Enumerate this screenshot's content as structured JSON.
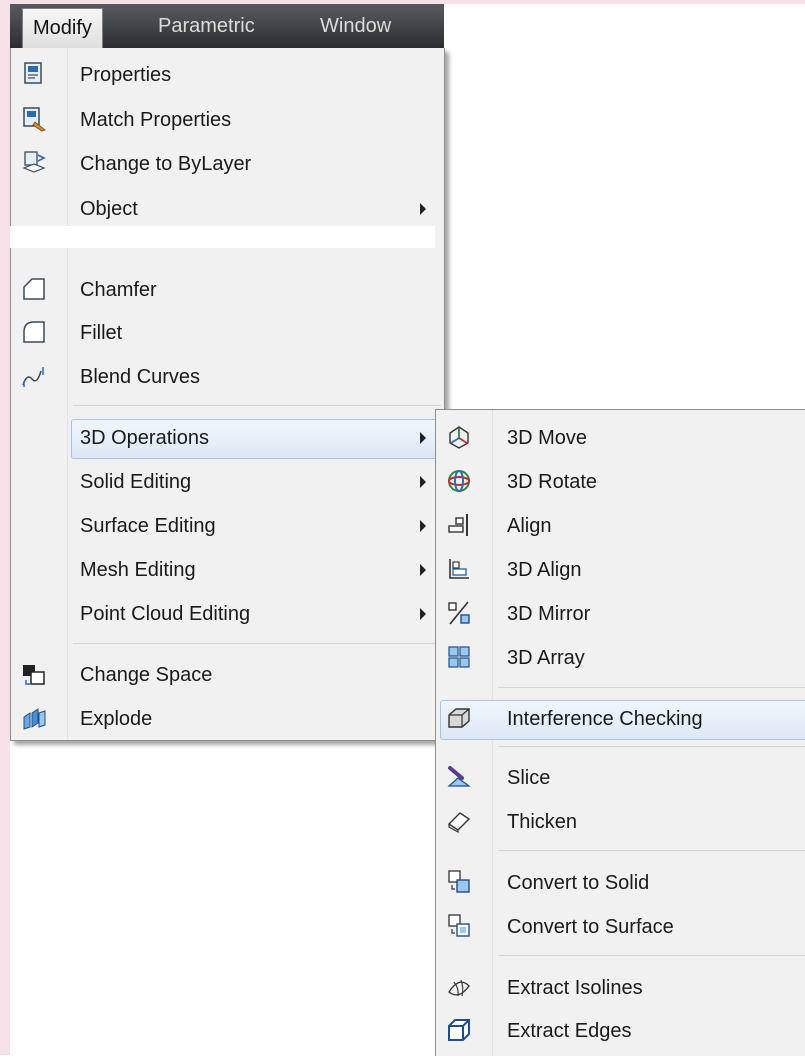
{
  "menubar": {
    "items": [
      "Modify",
      "Parametric",
      "Window"
    ]
  },
  "modify_menu": {
    "items": [
      {
        "label": "Properties",
        "icon": "properties-icon"
      },
      {
        "label": "Match Properties",
        "icon": "match-properties-icon"
      },
      {
        "label": "Change to ByLayer",
        "icon": "change-bylayer-icon"
      },
      {
        "label": "Object",
        "submenu": true
      },
      {
        "label": "Chamfer",
        "icon": "chamfer-icon"
      },
      {
        "label": "Fillet",
        "icon": "fillet-icon"
      },
      {
        "label": "Blend Curves",
        "icon": "blend-curves-icon"
      },
      {
        "label": "3D Operations",
        "submenu": true,
        "highlighted": true
      },
      {
        "label": "Solid Editing",
        "submenu": true
      },
      {
        "label": "Surface Editing",
        "submenu": true
      },
      {
        "label": "Mesh Editing",
        "submenu": true
      },
      {
        "label": "Point Cloud Editing",
        "submenu": true
      },
      {
        "label": "Change Space",
        "icon": "change-space-icon"
      },
      {
        "label": "Explode",
        "icon": "explode-icon"
      }
    ]
  },
  "operations_submenu": {
    "items": [
      {
        "label": "3D Move",
        "icon": "3d-move-icon"
      },
      {
        "label": "3D Rotate",
        "icon": "3d-rotate-icon"
      },
      {
        "label": "Align",
        "icon": "align-icon"
      },
      {
        "label": "3D Align",
        "icon": "3d-align-icon"
      },
      {
        "label": "3D Mirror",
        "icon": "3d-mirror-icon"
      },
      {
        "label": "3D Array",
        "icon": "3d-array-icon"
      },
      {
        "label": "Interference Checking",
        "icon": "interference-checking-icon",
        "highlighted": true
      },
      {
        "label": "Slice",
        "icon": "slice-icon"
      },
      {
        "label": "Thicken",
        "icon": "thicken-icon"
      },
      {
        "label": "Convert to Solid",
        "icon": "convert-to-solid-icon"
      },
      {
        "label": "Convert to Surface",
        "icon": "convert-to-surface-icon"
      },
      {
        "label": "Extract Isolines",
        "icon": "extract-isolines-icon"
      },
      {
        "label": "Extract Edges",
        "icon": "extract-edges-icon"
      }
    ]
  },
  "colors": {
    "menubar_bg": "#3a3c40",
    "menu_bg": "#f1f1f1",
    "highlight_border": "#a8c4e4",
    "icon_blue": "#2b6cb0"
  }
}
